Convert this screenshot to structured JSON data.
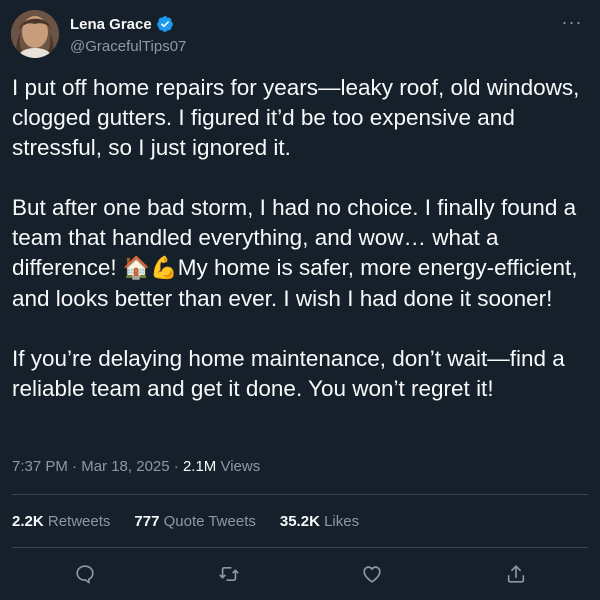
{
  "author": {
    "display_name": "Lena Grace",
    "handle": "@GracefulTips07",
    "verified_icon": "verified-badge-icon",
    "avatar_icon": "avatar"
  },
  "more_icon_label": "···",
  "tweet": {
    "paragraphs": [
      "I put off home repairs for years—leaky roof, old windows, clogged gutters. I figured it’d be too expensive and stressful, so I just ignored it.",
      "But after one bad storm, I had no choice. I finally found a team that handled everything, and wow… what a difference!",
      "If you’re delaying home maintenance, don’t wait—find a reliable team and get it done. You won’t regret it!"
    ],
    "paragraph2_after_emoji": "My home is safer, more energy-efficient, and looks better than ever. I wish I had done it sooner!",
    "emoji_1": "🏠",
    "emoji_2": "💪"
  },
  "meta": {
    "time": "7:37 PM",
    "separator": " · ",
    "date": "Mar 18, 2025",
    "views_count": "2.1M",
    "views_label": " Views"
  },
  "stats": {
    "retweets": {
      "count": "2.2K",
      "label": " Retweets"
    },
    "quotes": {
      "count": "777",
      "label": " Quote Tweets"
    },
    "likes": {
      "count": "35.2K",
      "label": " Likes"
    }
  },
  "actions": [
    "reply-icon",
    "retweet-icon",
    "like-icon",
    "share-icon"
  ],
  "colors": {
    "background": "#15202b",
    "text_primary": "#f7f9f9",
    "text_secondary": "#8b98a5",
    "divider": "#38444d",
    "verified": "#1d9bf0"
  }
}
